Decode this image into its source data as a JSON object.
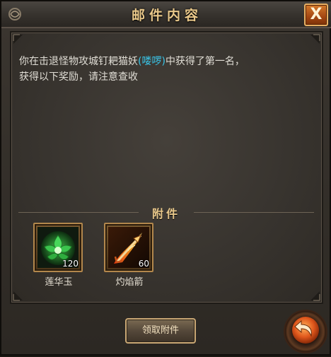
{
  "window": {
    "title": "邮件内容",
    "close_label": "X"
  },
  "message": {
    "part1": "你在击退怪物攻城钉耙猫妖",
    "highlight": "(喽啰)",
    "part2": "中获得了第一名，",
    "line2": "获得以下奖励，请注意查收"
  },
  "attachments": {
    "label": "附件",
    "items": [
      {
        "name": "莲华玉",
        "count": "120",
        "icon": "jade-lotus-icon"
      },
      {
        "name": "灼焰箭",
        "count": "60",
        "icon": "flame-arrow-icon"
      }
    ]
  },
  "actions": {
    "claim_label": "领取附件",
    "back_icon": "back-arrow-icon"
  },
  "colors": {
    "title": "#e9c88a",
    "highlight": "#39c6ea",
    "close_button": "#a44712"
  }
}
